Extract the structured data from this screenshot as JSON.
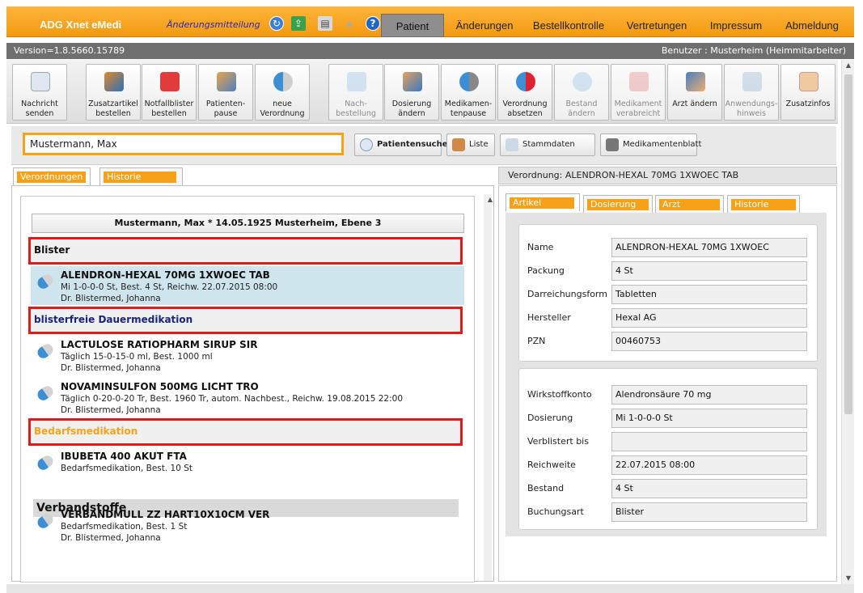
{
  "app": {
    "title": "ADG Xnet eMedi",
    "notify_link": "Änderungsmitteilung",
    "nav": [
      "Patient",
      "Änderungen",
      "Bestellkontrolle",
      "Vertretungen",
      "Impressum",
      "Abmeldung"
    ],
    "active_nav": "Patient",
    "icons": [
      "refresh-icon",
      "upload-icon",
      "print-icon",
      "lock-icon",
      "help-icon"
    ]
  },
  "status": {
    "version": "Version=1.8.5660.15789",
    "user": "Benutzer : Musterheim (Heimmitarbeiter)"
  },
  "toolbar": [
    {
      "label": "Nachricht\nsenden",
      "icon": "envelope-icon",
      "enabled": true
    },
    {
      "label": "Zusatzartikel\nbestellen",
      "icon": "boxes-icon",
      "enabled": true
    },
    {
      "label": "Notfallblister\nbestellen",
      "icon": "first-aid-icon",
      "enabled": true
    },
    {
      "label": "Patienten-\npause",
      "icon": "patient-pause-icon",
      "enabled": true
    },
    {
      "label": "neue\nVerordnung",
      "icon": "pill-icon",
      "enabled": true
    },
    {
      "label": "Nach-\nbestellung",
      "icon": "reorder-icon",
      "enabled": false
    },
    {
      "label": "Dosierung\nändern",
      "icon": "dosage-icon",
      "enabled": true
    },
    {
      "label": "Medikamen-\ntenpause",
      "icon": "clock-pill-icon",
      "enabled": true
    },
    {
      "label": "Verordnung\nabsetzen",
      "icon": "cancel-pill-icon",
      "enabled": true
    },
    {
      "label": "Bestand\nändern",
      "icon": "stock-icon",
      "enabled": false
    },
    {
      "label": "Medikament\nverabreicht",
      "icon": "blister-icon",
      "enabled": false
    },
    {
      "label": "Arzt ändern",
      "icon": "doctor-icon",
      "enabled": true
    },
    {
      "label": "Anwendungs-\nhinweis",
      "icon": "hint-icon",
      "enabled": false
    },
    {
      "label": "Zusatzinfos",
      "icon": "info-icon",
      "enabled": true
    }
  ],
  "search": {
    "value": "Mustermann, Max",
    "buttons": [
      "Patientensuche",
      "Liste",
      "Stammdaten",
      "Medikamentenblatt"
    ]
  },
  "left_tabs": [
    "Verordnungen",
    "Historie"
  ],
  "patient_header": "Mustermann, Max  * 14.05.1925  Musterheim, Ebene 3",
  "sections": {
    "blister": "Blister",
    "dauer": "blisterfreie Dauermedikation",
    "bedarf": "Bedarfsmedikation",
    "verband": "Verbandstoffe"
  },
  "meds": [
    {
      "name": "ALENDRON-HEXAL 70MG 1XWOEC TAB",
      "line1": "Mi 1-0-0-0 St, Best. 4 St, Reichw. 22.07.2015 08:00",
      "line2": "Dr. Blistermed, Johanna"
    },
    {
      "name": "LACTULOSE RATIOPHARM SIRUP SIR",
      "line1": "Täglich 15-0-15-0 ml, Best. 1000 ml",
      "line2": "Dr. Blistermed, Johanna"
    },
    {
      "name": "NOVAMINSULFON 500MG LICHT TRO",
      "line1": "Täglich 0-20-0-20 Tr, Best. 1960 Tr, autom. Nachbest., Reichw. 19.08.2015 22:00",
      "line2": "Dr. Blistermed, Johanna"
    },
    {
      "name": "IBUBETA 400 AKUT FTA",
      "line1": "Bedarfsmedikation, Best. 10 St",
      "line2": ""
    },
    {
      "name": "VERBANDMULL ZZ HART10X10CM VER",
      "line1": "Bedarfsmedikation, Best. 1 St",
      "line2": "Dr. Blistermed, Johanna"
    }
  ],
  "right": {
    "header": "Verordnung: ALENDRON-HEXAL 70MG 1XWOEC TAB",
    "tabs": [
      "Artikel",
      "Dosierung",
      "Arzt",
      "Historie"
    ],
    "group1": [
      {
        "label": "Name",
        "value": "ALENDRON-HEXAL 70MG 1XWOEC"
      },
      {
        "label": "Packung",
        "value": "4 St"
      },
      {
        "label": "Darreichungsform",
        "value": "Tabletten"
      },
      {
        "label": "Hersteller",
        "value": "Hexal AG"
      },
      {
        "label": "PZN",
        "value": "00460753"
      }
    ],
    "group2": [
      {
        "label": "Wirkstoffkonto",
        "value": "Alendronsäure 70 mg"
      },
      {
        "label": "Dosierung",
        "value": "Mi 1-0-0-0 St"
      },
      {
        "label": "Verblistert bis",
        "value": ""
      },
      {
        "label": "Reichweite",
        "value": "22.07.2015 08:00"
      },
      {
        "label": "Bestand",
        "value": "4 St"
      },
      {
        "label": "Buchungsart",
        "value": "Blister"
      }
    ]
  },
  "colors": {
    "accent": "#f5a219",
    "highlight": "#e01a1a",
    "dauer_text": "#1a237e",
    "bedarf_text": "#f5a219",
    "selected_row": "#cfe5ee"
  }
}
